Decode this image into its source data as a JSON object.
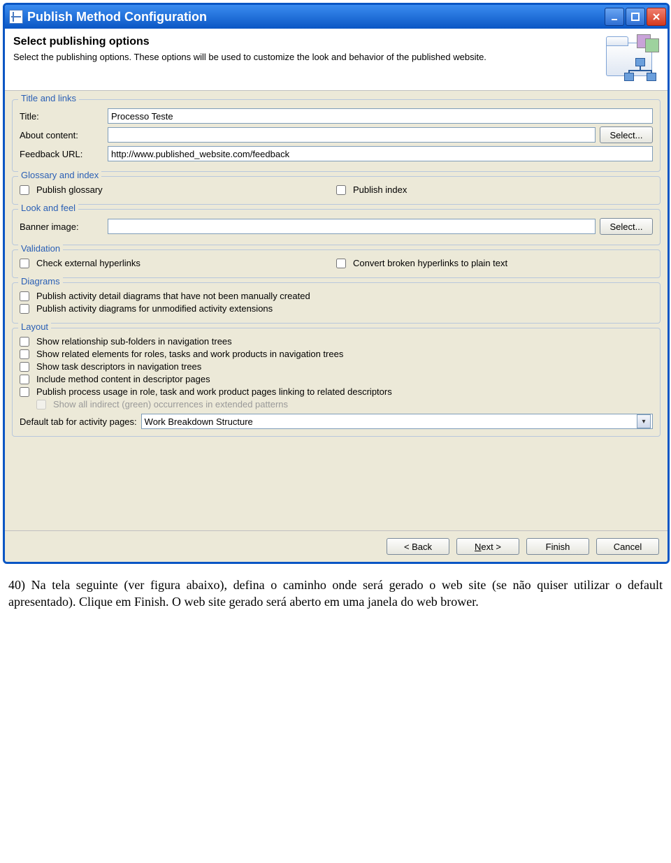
{
  "window": {
    "title": "Publish Method Configuration"
  },
  "header": {
    "heading": "Select publishing options",
    "description": "Select the publishing options. These options will be used to customize the look and behavior of the published website."
  },
  "groups": {
    "title_links": {
      "legend": "Title and links",
      "title_label": "Title:",
      "title_value": "Processo Teste",
      "about_label": "About content:",
      "about_value": "",
      "select_label": "Select...",
      "feedback_label": "Feedback URL:",
      "feedback_value": "http://www.published_website.com/feedback"
    },
    "glossary": {
      "legend": "Glossary and index",
      "publish_glossary": "Publish glossary",
      "publish_index": "Publish index"
    },
    "look": {
      "legend": "Look and feel",
      "banner_label": "Banner image:",
      "banner_value": "",
      "select_label": "Select..."
    },
    "validation": {
      "legend": "Validation",
      "check_ext": "Check external hyperlinks",
      "convert_broken": "Convert broken hyperlinks to plain text"
    },
    "diagrams": {
      "legend": "Diagrams",
      "opt1": "Publish activity detail diagrams that have not been manually created",
      "opt2": "Publish activity diagrams for unmodified activity extensions"
    },
    "layout": {
      "legend": "Layout",
      "opt1": "Show relationship sub-folders in navigation trees",
      "opt2": "Show related elements for roles, tasks and work products in navigation trees",
      "opt3": "Show task descriptors in navigation trees",
      "opt4": "Include method content in descriptor pages",
      "opt5": "Publish process usage in role, task and work product pages linking to related descriptors",
      "opt6": "Show all indirect (green) occurrences in extended patterns",
      "default_tab_label": "Default tab for activity pages:",
      "default_tab_value": "Work Breakdown Structure"
    }
  },
  "footer": {
    "back": "< Back",
    "next": "Next >",
    "finish": "Finish",
    "cancel": "Cancel"
  },
  "caption": "40) Na tela seguinte (ver figura abaixo), defina o caminho onde será gerado o web site (se não quiser utilizar o default apresentado). Clique em Finish. O web site gerado será aberto em uma janela do web brower."
}
